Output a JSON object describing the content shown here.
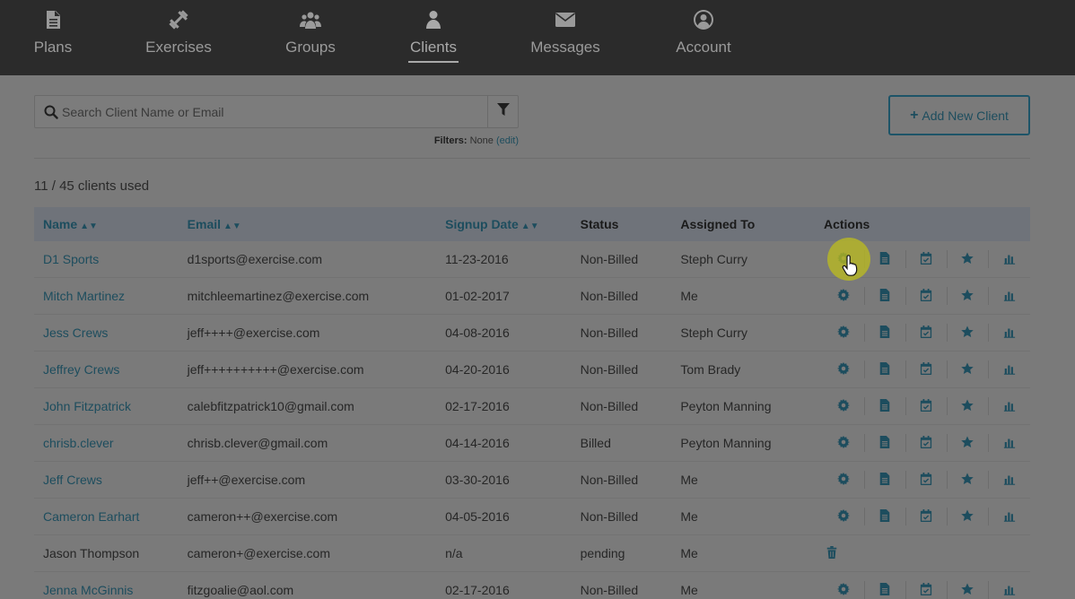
{
  "nav": {
    "items": [
      {
        "label": "Plans",
        "icon": "document-icon"
      },
      {
        "label": "Exercises",
        "icon": "dumbbell-icon"
      },
      {
        "label": "Groups",
        "icon": "users-icon"
      },
      {
        "label": "Clients",
        "icon": "user-icon",
        "active": true
      },
      {
        "label": "Messages",
        "icon": "envelope-icon"
      },
      {
        "label": "Account",
        "icon": "account-circle-icon"
      }
    ]
  },
  "search": {
    "placeholder": "Search Client Name or Email",
    "value": ""
  },
  "filters": {
    "label": "Filters:",
    "value": "None",
    "edit": "(edit)"
  },
  "add_client": {
    "plus": "+",
    "label": "Add New Client"
  },
  "usage": "11 / 45 clients used",
  "table": {
    "headers": {
      "name": "Name",
      "email": "Email",
      "signup": "Signup Date",
      "status": "Status",
      "assigned": "Assigned To",
      "actions": "Actions"
    },
    "rows": [
      {
        "name": "D1 Sports",
        "email": "d1sports@exercise.com",
        "signup": "11-23-2016",
        "status": "Non-Billed",
        "assigned": "Steph Curry"
      },
      {
        "name": "Mitch Martinez",
        "email": "mitchleemartinez@exercise.com",
        "signup": "01-02-2017",
        "status": "Non-Billed",
        "assigned": "Me"
      },
      {
        "name": "Jess Crews",
        "email": "jeff++++@exercise.com",
        "signup": "04-08-2016",
        "status": "Non-Billed",
        "assigned": "Steph Curry"
      },
      {
        "name": "Jeffrey Crews",
        "email": "jeff++++++++++@exercise.com",
        "signup": "04-20-2016",
        "status": "Non-Billed",
        "assigned": "Tom Brady"
      },
      {
        "name": "John Fitzpatrick",
        "email": "calebfitzpatrick10@gmail.com",
        "signup": "02-17-2016",
        "status": "Non-Billed",
        "assigned": "Peyton Manning"
      },
      {
        "name": "chrisb.clever",
        "email": "chrisb.clever@gmail.com",
        "signup": "04-14-2016",
        "status": "Billed",
        "assigned": "Peyton Manning"
      },
      {
        "name": "Jeff Crews",
        "email": "jeff++@exercise.com",
        "signup": "03-30-2016",
        "status": "Non-Billed",
        "assigned": "Me"
      },
      {
        "name": "Cameron Earhart",
        "email": "cameron++@exercise.com",
        "signup": "04-05-2016",
        "status": "Non-Billed",
        "assigned": "Me"
      },
      {
        "name": "Jason Thompson",
        "email": "cameron+@exercise.com",
        "signup": "n/a",
        "status": "pending",
        "assigned": "Me"
      },
      {
        "name": "Jenna McGinnis",
        "email": "fitzgoalie@aol.com",
        "signup": "02-17-2016",
        "status": "Non-Billed",
        "assigned": "Me"
      }
    ]
  },
  "colors": {
    "accent": "#1d4d5e",
    "nav_bg": "#2b2b2b",
    "page_bg": "#7a7a7a",
    "header_row_bg": "#6f737a",
    "cursor_highlight": "#bebe1e"
  }
}
